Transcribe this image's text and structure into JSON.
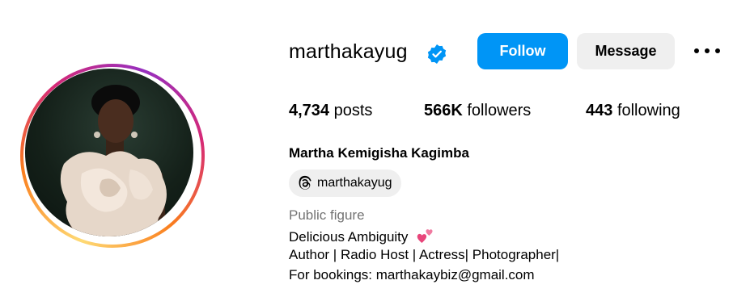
{
  "profile": {
    "username": "marthakayug",
    "full_name": "Martha Kemigisha Kagimba",
    "verified": true,
    "category": "Public figure",
    "threads_handle": "marthakayug",
    "bio": [
      "Delicious Ambiguity",
      "Author | Radio Host | Actress| Photographer|",
      "For bookings: marthakaybiz@gmail.com"
    ],
    "bio_emoji_icon": "two-hearts-icon"
  },
  "actions": {
    "follow_label": "Follow",
    "message_label": "Message",
    "more_icon": "more-options-icon"
  },
  "stats": {
    "posts_value": "4,734",
    "posts_label": "posts",
    "followers_value": "566K",
    "followers_label": "followers",
    "following_value": "443",
    "following_label": "following"
  },
  "colors": {
    "follow_blue": "#0095f6",
    "verified_blue": "#0095f6",
    "secondary_button": "#efefef",
    "muted_text": "#737373",
    "story_ring": [
      "#feda75",
      "#fa7e1e",
      "#d62976",
      "#962fbf"
    ]
  }
}
